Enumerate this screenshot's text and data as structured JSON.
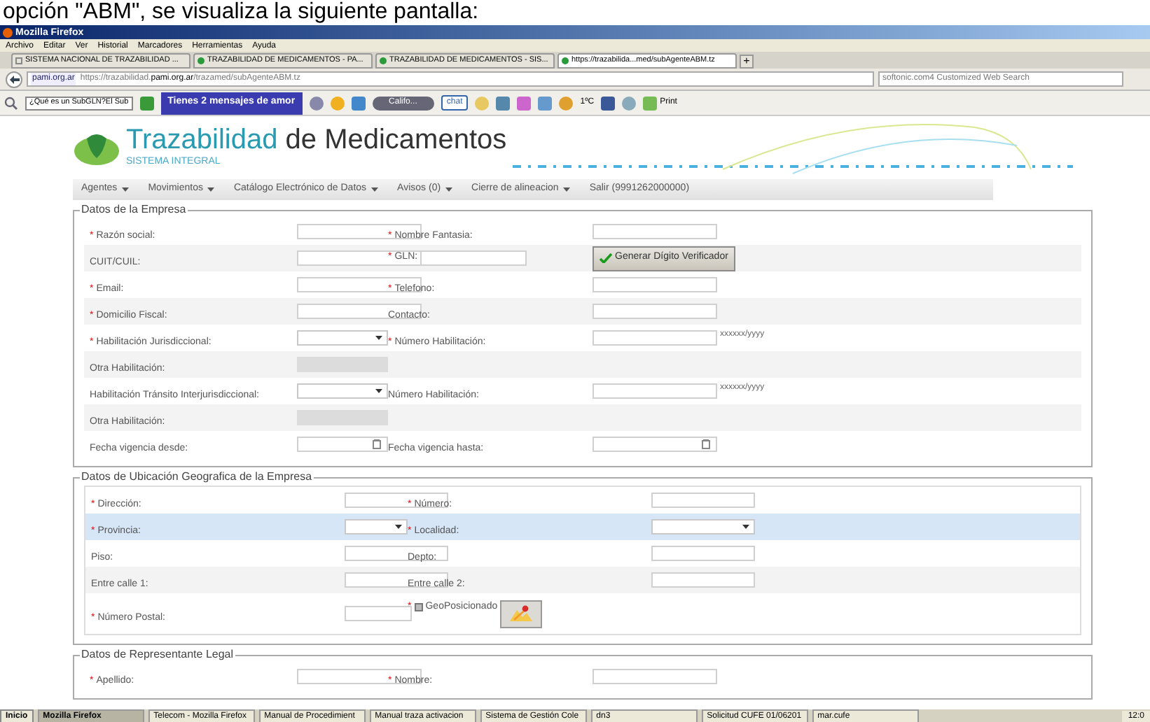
{
  "document_text": "opción \"ABM\", se visualiza la siguiente pantalla:",
  "window": {
    "title": "Mozilla Firefox"
  },
  "menu": [
    "Archivo",
    "Editar",
    "Ver",
    "Historial",
    "Marcadores",
    "Herramientas",
    "Ayuda"
  ],
  "tabs": [
    {
      "label": "SISTEMA NACIONAL DE TRAZABILIDAD ...",
      "selected": false,
      "kind": "plain"
    },
    {
      "label": "TRAZABILIDAD DE MEDICAMENTOS - PA...",
      "selected": false,
      "kind": "site"
    },
    {
      "label": "TRAZABILIDAD DE MEDICAMENTOS - SIS...",
      "selected": false,
      "kind": "site"
    },
    {
      "label": "https://trazabilida...med/subAgenteABM.tz",
      "selected": true,
      "kind": "site"
    }
  ],
  "new_tab": "+",
  "address_bar": {
    "site": "pami.org.ar",
    "url_start": "https://trazabilidad.",
    "url_domain": "pami.org.ar",
    "url_end": "/trazamed/subAgenteABM.tz"
  },
  "search": {
    "placeholder": "softonic.com4 Customized Web Search"
  },
  "toolbar": {
    "query": "¿Qué es un SubGLN?El Sub",
    "banner": "Tienes 2 mensajes de amor",
    "radio": "Califo...",
    "chat": "chat",
    "weather": "1ºC",
    "print": "Print"
  },
  "app": {
    "title_main": "Trazabilidad",
    "title_rest": "de Medicamentos",
    "subtitle": "SISTEMA INTEGRAL"
  },
  "nav": [
    {
      "label": "Agentes",
      "has_menu": true
    },
    {
      "label": "Movimientos",
      "has_menu": true
    },
    {
      "label": "Catálogo Electrónico de Datos",
      "has_menu": true
    },
    {
      "label": "Avisos (0)",
      "has_menu": true
    },
    {
      "label": "Cierre de alineacion",
      "has_menu": true
    },
    {
      "label": "Salir (9991262000000)",
      "has_menu": false
    }
  ],
  "sections": [
    {
      "title": "Datos de la Empresa",
      "rows": [
        {
          "highlighted": false,
          "cells": [
            {
              "label": "Razón social:",
              "mark": "*",
              "kind": "text"
            },
            {
              "label": "Nombre Fantasia:",
              "mark": "*",
              "kind": "text"
            }
          ]
        },
        {
          "highlighted": false,
          "cells": [
            {
              "label": "CUIT/CUIL:",
              "kind": "text"
            },
            {
              "label": "GLN:",
              "mark": "*",
              "kind": "inline_button",
              "button": "Generar Dígito Verificador"
            }
          ]
        },
        {
          "highlighted": false,
          "cells": [
            {
              "label": "Email:",
              "mark": "*",
              "kind": "text"
            },
            {
              "label": "Telefono:",
              "mark": "*",
              "kind": "text"
            }
          ]
        },
        {
          "highlighted": false,
          "cells": [
            {
              "label": "Domicilio Fiscal:",
              "mark": "*",
              "kind": "text"
            },
            {
              "label": "Contacto:",
              "kind": "text"
            }
          ]
        },
        {
          "highlighted": false,
          "cells": [
            {
              "label": "Habilitación Jurisdiccional:",
              "mark": "*",
              "kind": "select"
            },
            {
              "label": "Número Habilitación:",
              "mark": "*",
              "kind": "text",
              "hint": "xxxxxx/yyyy"
            }
          ]
        },
        {
          "highlighted": false,
          "cells": [
            {
              "label": "Otra Habilitación:",
              "kind": "disabled"
            },
            {
              "kind": "none"
            }
          ]
        },
        {
          "highlighted": false,
          "cells": [
            {
              "label": "Habilitación Tránsito Interjurisdiccional:",
              "kind": "select"
            },
            {
              "label": "Número Habilitación:",
              "kind": "text",
              "hint": "xxxxxx/yyyy"
            }
          ]
        },
        {
          "highlighted": false,
          "cells": [
            {
              "label": "Otra Habilitación:",
              "kind": "disabled"
            },
            {
              "kind": "none"
            }
          ]
        },
        {
          "highlighted": false,
          "cells": [
            {
              "label": "Fecha vigencia desde:",
              "kind": "date"
            },
            {
              "label": "Fecha vigencia hasta:",
              "kind": "date"
            }
          ]
        }
      ]
    },
    {
      "title": "Datos de Ubicación Geografica de la Empresa",
      "rows": [
        {
          "highlighted": false,
          "cells": [
            {
              "label": "Dirección:",
              "mark": "*",
              "kind": "text"
            },
            {
              "label": "Número:",
              "mark": "*",
              "kind": "text"
            }
          ]
        },
        {
          "highlighted": true,
          "cells": [
            {
              "label": "Provincia:",
              "mark": "*",
              "kind": "select"
            },
            {
              "label": "Localidad:",
              "mark": "*",
              "kind": "select"
            }
          ]
        },
        {
          "highlighted": false,
          "cells": [
            {
              "label": "Piso:",
              "kind": "text"
            },
            {
              "label": "Depto:",
              "kind": "text"
            }
          ]
        },
        {
          "highlighted": false,
          "cells": [
            {
              "label": "Entre calle 1:",
              "kind": "text"
            },
            {
              "label": "Entre calle 2:",
              "kind": "text"
            }
          ]
        },
        {
          "highlighted": false,
          "cells": [
            {
              "label": "Número Postal:",
              "mark": "*",
              "kind": "short"
            },
            {
              "label": "GeoPosicionado",
              "mark": "*",
              "kind": "checkbox_map",
              "checked": false
            }
          ]
        }
      ]
    },
    {
      "title": "Datos de Representante Legal",
      "rows": [
        {
          "highlighted": false,
          "cells": [
            {
              "label": "Apellido:",
              "mark": "*",
              "kind": "text"
            },
            {
              "label": "Nombre:",
              "mark": "*",
              "kind": "text"
            }
          ]
        }
      ]
    }
  ],
  "taskbar": {
    "start": "Inicio",
    "items": [
      {
        "label": "Mozilla Firefox",
        "selected": true
      },
      {
        "label": "Telecom - Mozilla Firefox",
        "selected": false
      },
      {
        "label": "Manual de Procedimient",
        "selected": false
      },
      {
        "label": "Manual traza activacion",
        "selected": false
      },
      {
        "label": "Sistema de Gestión Cole",
        "selected": false
      },
      {
        "label": "dn3",
        "selected": false
      },
      {
        "label": "Solicitud CUFE 01/06201",
        "selected": false
      },
      {
        "label": "mar.cufe",
        "selected": false
      }
    ],
    "clock": "12:0"
  }
}
